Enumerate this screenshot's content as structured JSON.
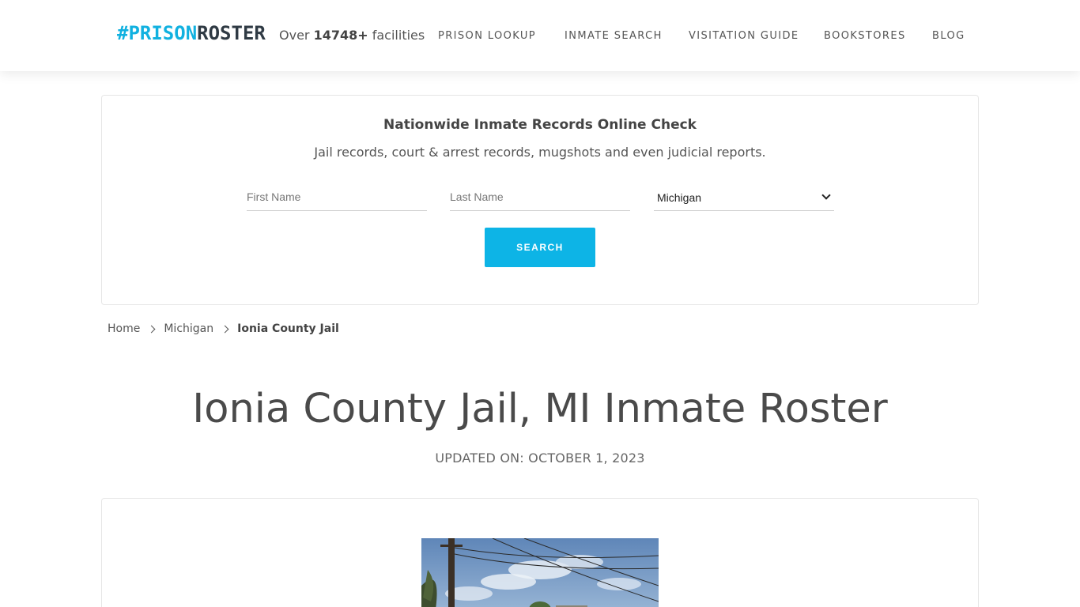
{
  "header": {
    "logo": {
      "hash": "#",
      "prison": "PRISON",
      "roster": "ROSTER"
    },
    "tagline": {
      "prefix": "Over ",
      "count": "14748+",
      "suffix": " facilities"
    },
    "nav": [
      "PRISON LOOKUP",
      "INMATE SEARCH",
      "VISITATION GUIDE",
      "BOOKSTORES",
      "BLOG"
    ]
  },
  "search": {
    "title": "Nationwide Inmate Records Online Check",
    "subtitle": "Jail records, court & arrest records, mugshots and even judicial reports.",
    "first_name_placeholder": "First Name",
    "last_name_placeholder": "Last Name",
    "state_selected": "Michigan",
    "button_label": "SEARCH"
  },
  "breadcrumb": {
    "home": "Home",
    "state": "Michigan",
    "current": "Ionia County Jail"
  },
  "page": {
    "title": "Ionia County Jail, MI Inmate Roster",
    "updated": "UPDATED ON: OCTOBER 1, 2023"
  },
  "colors": {
    "accent": "#0db4e6",
    "logo_dark": "#2f3a44",
    "text": "#555555"
  }
}
